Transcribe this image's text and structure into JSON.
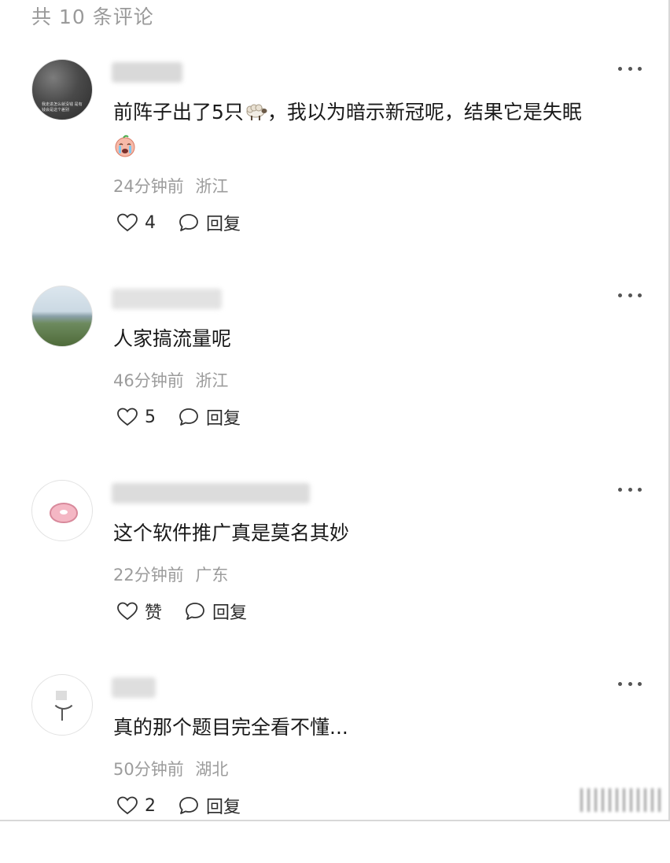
{
  "header": {
    "count_label": "共 10 条评论"
  },
  "comments": [
    {
      "content": "前阵子出了5只",
      "content_tail": "，我以为暗示新冠呢，结果它是失眠",
      "emojis": [
        "sheep-emoji",
        "crying-face-emoji"
      ],
      "time": "24分钟前",
      "location": "浙江",
      "likes": "4",
      "reply_label": "回复",
      "avatar_text": "我走进怎么就没钱 是有钱会是这个差别",
      "name_redacted": true
    },
    {
      "content": "人家搞流量呢",
      "time": "46分钟前",
      "location": "浙江",
      "likes": "5",
      "reply_label": "回复",
      "name_redacted": true
    },
    {
      "content": "这个软件推广真是莫名其妙",
      "time": "22分钟前",
      "location": "广东",
      "likes": "赞",
      "reply_label": "回复",
      "name_redacted": true
    },
    {
      "content": "真的那个题目完全看不懂...",
      "time": "50分钟前",
      "location": "湖北",
      "likes": "2",
      "reply_label": "回复",
      "name_redacted": true
    }
  ],
  "icons": {
    "like": "heart-outline-icon",
    "reply": "speech-bubble-icon",
    "more": "more-horizontal-icon"
  },
  "colors": {
    "meta_text": "#9c9c9c",
    "header_text": "#9a9a9a",
    "body_text": "#1a1a1a"
  }
}
